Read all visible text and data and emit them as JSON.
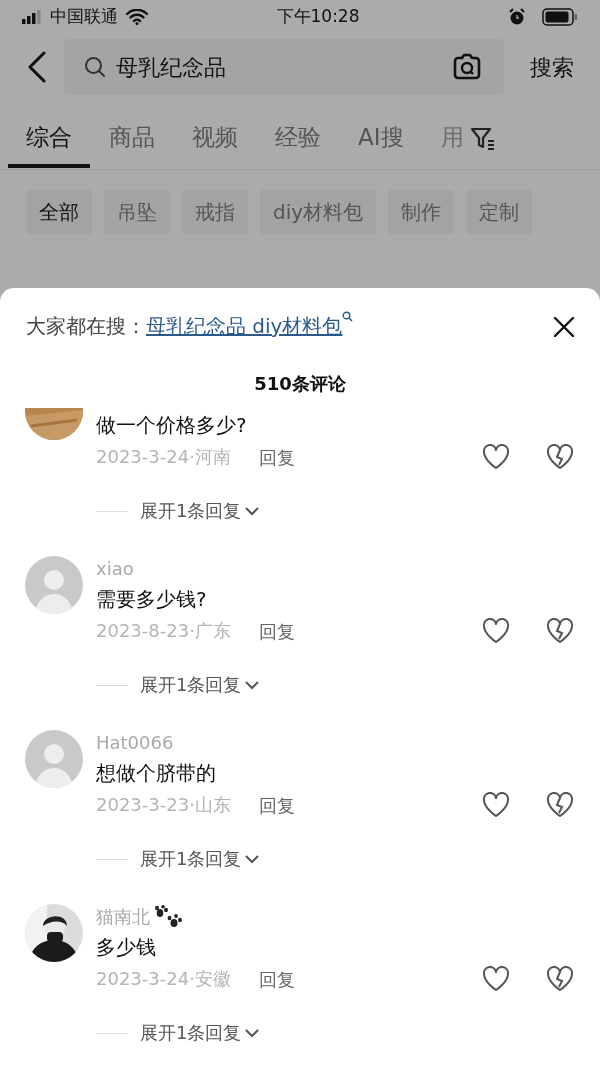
{
  "status_bar": {
    "carrier": "中国联通",
    "time": "下午10:28"
  },
  "search": {
    "query": "母乳纪念品",
    "button": "搜索"
  },
  "tabs": [
    {
      "label": "综合",
      "selected": true
    },
    {
      "label": "商品",
      "selected": false
    },
    {
      "label": "视频",
      "selected": false
    },
    {
      "label": "经验",
      "selected": false
    },
    {
      "label": "AI搜",
      "selected": false
    },
    {
      "label": "用",
      "selected": false
    }
  ],
  "chips": [
    {
      "label": "全部",
      "selected": true
    },
    {
      "label": "吊坠",
      "selected": false
    },
    {
      "label": "戒指",
      "selected": false
    },
    {
      "label": "diy材料包",
      "selected": false
    },
    {
      "label": "制作",
      "selected": false
    },
    {
      "label": "定制",
      "selected": false
    }
  ],
  "comments_sheet": {
    "suggestion_label": "大家都在搜：",
    "suggestion": "母乳纪念品 diy材料包",
    "comment_count": "510条评论",
    "comments": [
      {
        "photo_avatar": true,
        "text": "做一个价格多少?",
        "meta": "2023-3-24·河南",
        "reply": "回复",
        "expand": "展开1条回复"
      },
      {
        "photo_avatar": false,
        "username": "xiao",
        "badge": false,
        "text": "需要多少钱?",
        "meta": "2023-8-23·广东",
        "reply": "回复",
        "expand": "展开1条回复"
      },
      {
        "photo_avatar": false,
        "username": "Hat0066",
        "badge": false,
        "text": "想做个脐带的",
        "meta": "2023-3-23·山东",
        "reply": "回复",
        "expand": "展开1条回复"
      },
      {
        "photo_avatar": true,
        "username": "猫南北",
        "badge": true,
        "text": "多少钱",
        "meta": "2023-3-24·安徽",
        "reply": "回复",
        "expand": "展开1条回复"
      }
    ]
  }
}
